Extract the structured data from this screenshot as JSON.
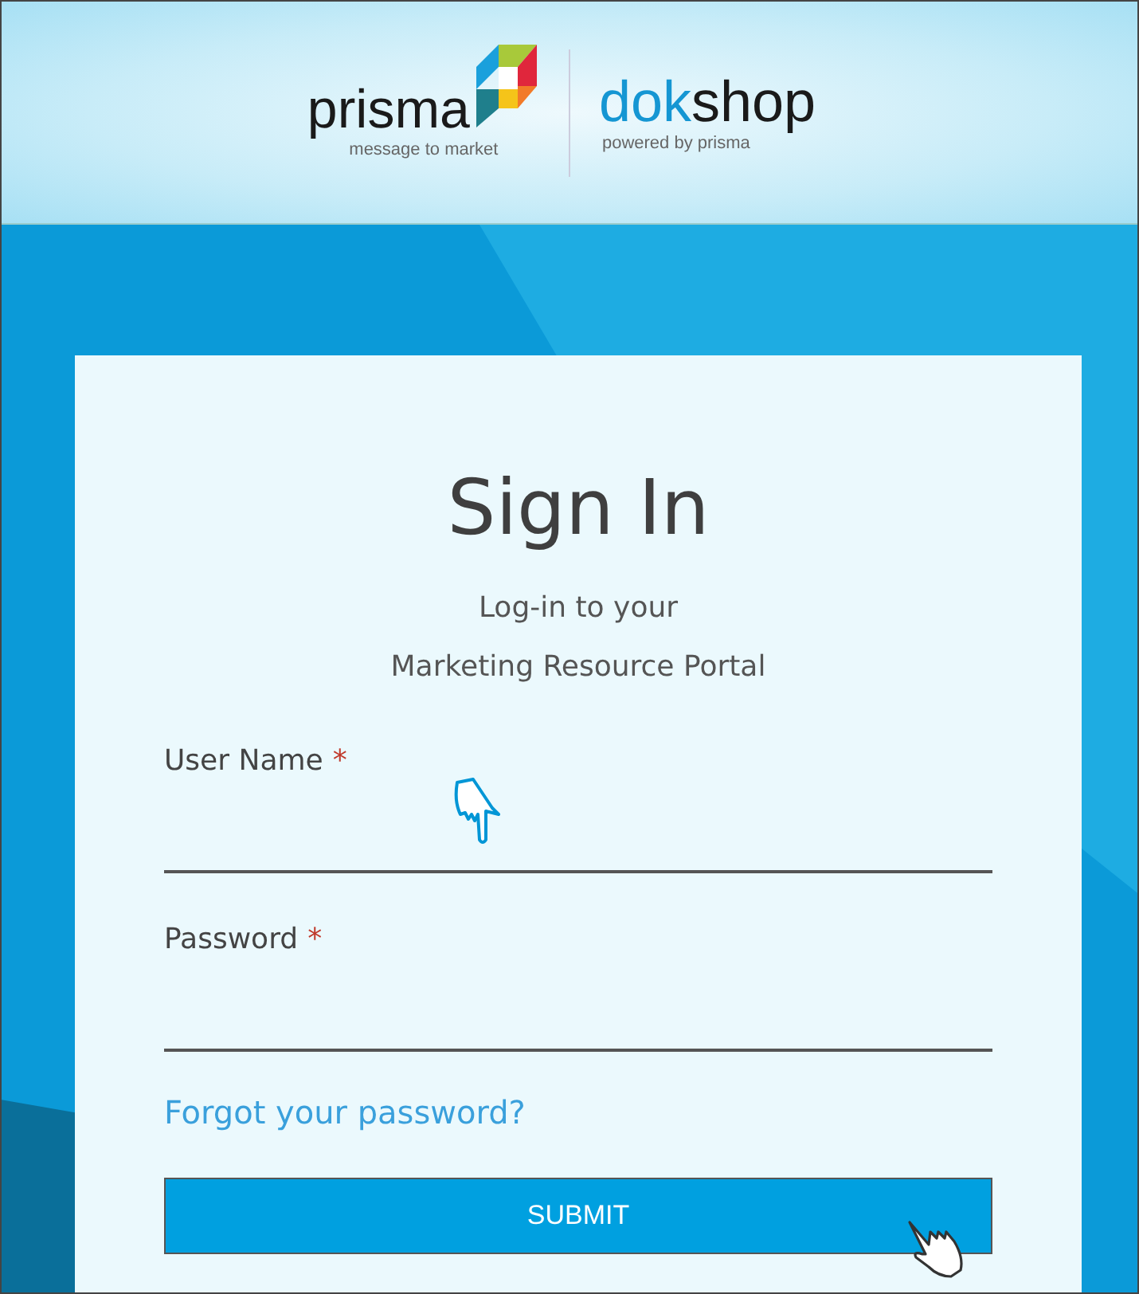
{
  "header": {
    "brand": "prisma",
    "brand_tagline": "message to market",
    "shop_accent": "dok",
    "shop_rest": "shop",
    "shop_tagline": "powered by prisma"
  },
  "card": {
    "title": "Sign In",
    "subtitle_lines": [
      "Log-in to your",
      "Marketing Resource Portal"
    ],
    "fields": [
      {
        "label": "User Name",
        "required_mark": "*"
      },
      {
        "label": "Password",
        "required_mark": "*"
      }
    ],
    "forgot_link": "Forgot your password?",
    "submit": "SUBMIT"
  }
}
